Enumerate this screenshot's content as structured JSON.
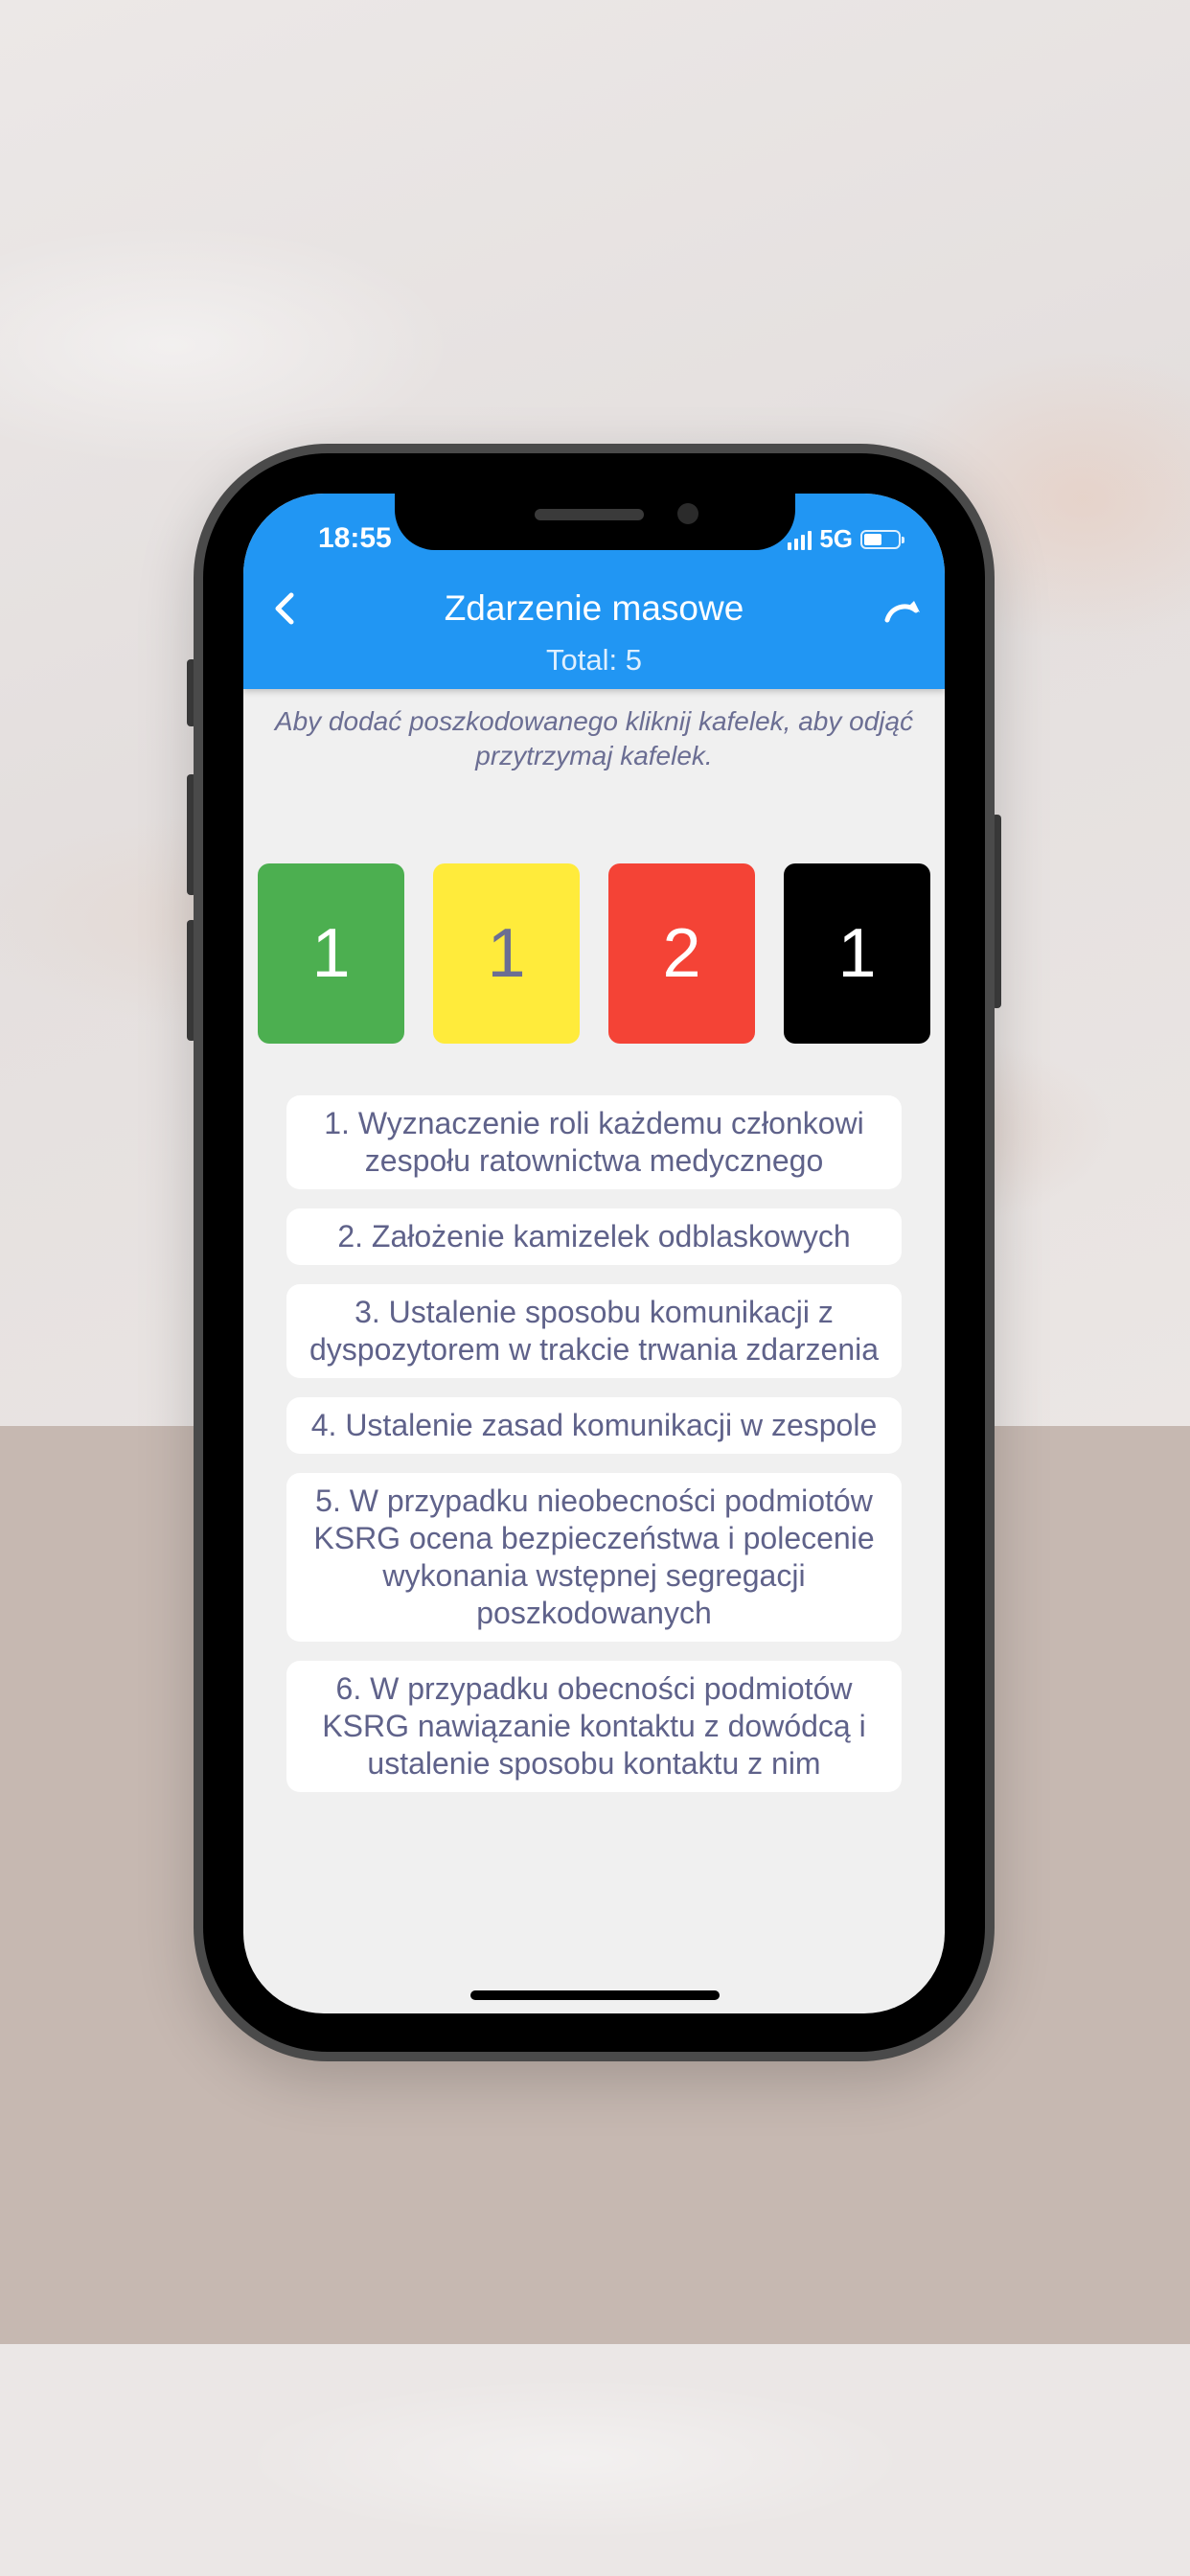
{
  "status_bar": {
    "time": "18:55",
    "network": "5G",
    "signal_icon": "signal-bars-icon",
    "battery_icon": "battery-icon"
  },
  "header": {
    "title": "Zdarzenie masowe",
    "subtitle": "Total: 5",
    "back_icon": "chevron-left-icon",
    "action_icon": "redo-arrow-icon",
    "color": "#2196f3"
  },
  "hint": "Aby dodać poszkodowanego kliknij kafelek, aby odjąć przytrzymaj kafelek.",
  "tiles": [
    {
      "value": "1",
      "color": "#4caf50"
    },
    {
      "value": "1",
      "color": "#ffeb3b"
    },
    {
      "value": "2",
      "color": "#f44336"
    },
    {
      "value": "1",
      "color": "#000000"
    }
  ],
  "steps": [
    "1. Wyznaczenie roli każdemu członkowi zespołu ratownictwa medycznego",
    "2. Założenie kamizelek odblaskowych",
    "3. Ustalenie sposobu komunikacji z dyspozytorem w trakcie trwania zdarzenia",
    "4. Ustalenie zasad komunikacji w zespole",
    "5. W przypadku nieobecności podmiotów KSRG ocena bezpieczeństwa  i polecenie wykonania wstępnej segregacji poszkodowanych",
    "6. W przypadku obecności podmiotów KSRG nawiązanie kontaktu z  dowódcą i  ustalenie sposobu kontaktu z nim"
  ]
}
